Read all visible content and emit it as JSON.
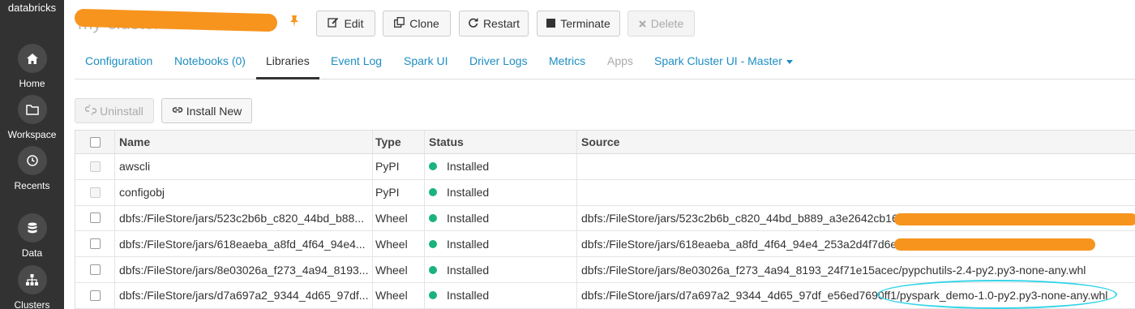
{
  "brand": "databricks",
  "sidebar": {
    "items": [
      {
        "label": "Home",
        "icon": "home-icon"
      },
      {
        "label": "Workspace",
        "icon": "folder-icon"
      },
      {
        "label": "Recents",
        "icon": "clock-icon"
      },
      {
        "label": "Data",
        "icon": "database-icon"
      },
      {
        "label": "Clusters",
        "icon": "sitemap-icon"
      }
    ]
  },
  "header": {
    "cluster_name": "my-cluster",
    "buttons": {
      "edit": "Edit",
      "clone": "Clone",
      "restart": "Restart",
      "terminate": "Terminate",
      "delete": "Delete"
    }
  },
  "tabs": [
    {
      "label": "Configuration"
    },
    {
      "label": "Notebooks (0)"
    },
    {
      "label": "Libraries"
    },
    {
      "label": "Event Log"
    },
    {
      "label": "Spark UI"
    },
    {
      "label": "Driver Logs"
    },
    {
      "label": "Metrics"
    },
    {
      "label": "Apps"
    },
    {
      "label": "Spark Cluster UI - Master"
    }
  ],
  "actions": {
    "uninstall": "Uninstall",
    "install_new": "Install New"
  },
  "table": {
    "columns": {
      "name": "Name",
      "type": "Type",
      "status": "Status",
      "source": "Source"
    },
    "rows": [
      {
        "name": "awscli",
        "type": "PyPI",
        "status": "Installed",
        "source": ""
      },
      {
        "name": "configobj",
        "type": "PyPI",
        "status": "Installed",
        "source": ""
      },
      {
        "name": "dbfs:/FileStore/jars/523c2b6b_c820_44bd_b88...",
        "type": "Wheel",
        "status": "Installed",
        "source": "dbfs:/FileStore/jars/523c2b6b_c820_44bd_b889_a3e2642cb16f"
      },
      {
        "name": "dbfs:/FileStore/jars/618eaeba_a8fd_4f64_94e4...",
        "type": "Wheel",
        "status": "Installed",
        "source": "dbfs:/FileStore/jars/618eaeba_a8fd_4f64_94e4_253a2d4f7d6e"
      },
      {
        "name": "dbfs:/FileStore/jars/8e03026a_f273_4a94_8193...",
        "type": "Wheel",
        "status": "Installed",
        "source": "dbfs:/FileStore/jars/8e03026a_f273_4a94_8193_24f71e15acec/pypchutils-2.4-py2.py3-none-any.whl"
      },
      {
        "name": "dbfs:/FileStore/jars/d7a697a2_9344_4d65_97df...",
        "type": "Wheel",
        "status": "Installed",
        "source": "dbfs:/FileStore/jars/d7a697a2_9344_4d65_97df_e56ed7690ff1/pyspark_demo-1.0-py2.py3-none-any.whl"
      }
    ]
  },
  "colors": {
    "sidebar_bg": "#323232",
    "link": "#1d8ec2",
    "status_installed": "#1ab37c",
    "redaction": "#f7941d",
    "highlight": "#33d4e8"
  }
}
